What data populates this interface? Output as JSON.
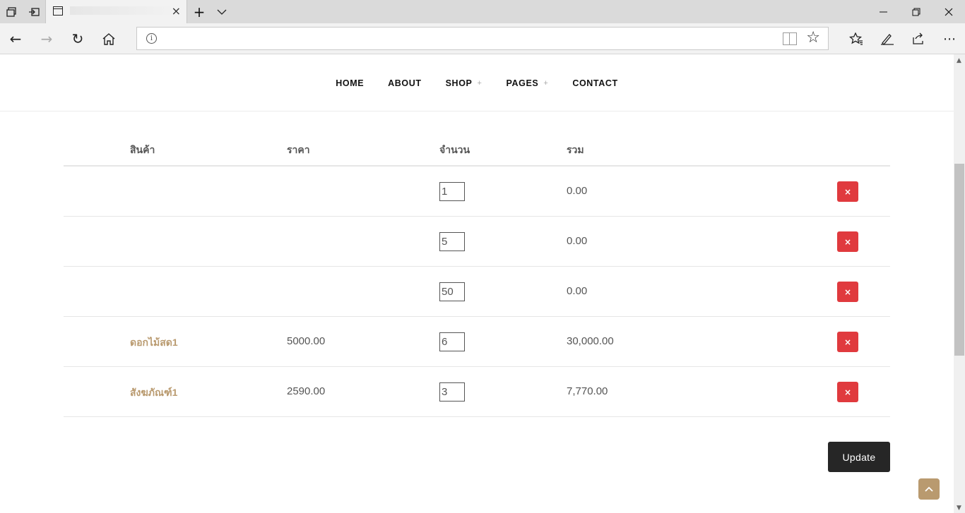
{
  "browser": {
    "new_tab_symbol": "+",
    "close_tab_symbol": "×",
    "back_symbol": "←",
    "forward_symbol": "→",
    "refresh_symbol": "↻",
    "more_symbol": "⋯"
  },
  "menu": {
    "items": [
      {
        "label": "HOME",
        "has_submenu": false
      },
      {
        "label": "ABOUT",
        "has_submenu": false
      },
      {
        "label": "SHOP",
        "has_submenu": true
      },
      {
        "label": "PAGES",
        "has_submenu": true
      },
      {
        "label": "CONTACT",
        "has_submenu": false
      }
    ],
    "submenu_symbol": "+"
  },
  "cart": {
    "headers": {
      "product": "สินค้า",
      "price": "ราคา",
      "quantity": "จำนวน",
      "total": "รวม"
    },
    "rows": [
      {
        "product": "",
        "price": "",
        "qty": "1",
        "total": "0.00"
      },
      {
        "product": "",
        "price": "",
        "qty": "5",
        "total": "0.00"
      },
      {
        "product": "",
        "price": "",
        "qty": "50",
        "total": "0.00"
      },
      {
        "product": "ดอกไม้สด1",
        "price": "5000.00",
        "qty": "6",
        "total": "30,000.00"
      },
      {
        "product": "สังฆภัณฑ์1",
        "price": "2590.00",
        "qty": "3",
        "total": "7,770.00"
      }
    ],
    "remove_symbol": "×",
    "update_label": "Update"
  },
  "colors": {
    "accent": "#b99a6f",
    "remove": "#e03a3e",
    "button_dark": "#262626"
  },
  "icons": [
    "tab-set-aside-icon",
    "tab-preview-icon",
    "page-icon",
    "info-icon",
    "reading-view-icon",
    "favorite-star-icon",
    "favorites-hub-icon",
    "pen-icon",
    "share-icon",
    "home-icon",
    "chevron-up-icon"
  ]
}
